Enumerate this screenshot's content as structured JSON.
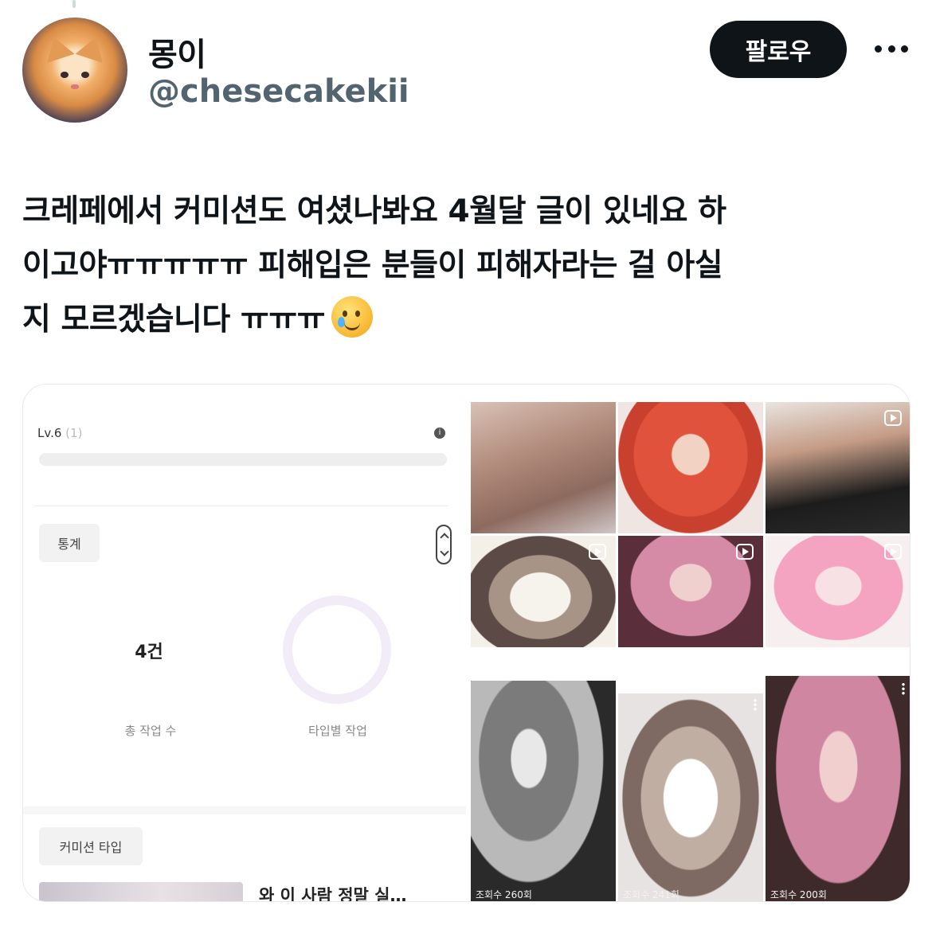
{
  "tweet": {
    "author": {
      "display_name": "몽이",
      "handle": "@chesecakekii",
      "avatar_icon": "kitten-avatar"
    },
    "follow_label": "팔로우",
    "more_icon": "more-horizontal-icon",
    "text": "크레페에서 커미션도 여셨나봐요 4월달 글이 있네요 하\n이고야ㅠㅠㅠㅠㅠ 피해입은 분들이 피해자라는 걸 아실\n지 모르겠습니다 ㅠㅠㅠ",
    "emoji": "smiling-face-with-tear",
    "colors": {
      "text": "#0f1419",
      "secondary": "#536471",
      "follow_bg": "#0f1419"
    }
  },
  "media": {
    "left_screenshot": {
      "level_label": "Lv.6",
      "level_count": "(1)",
      "stats_tab": "통계",
      "total_value": "4건",
      "total_label": "총 작업 수",
      "type_label": "타입별 작업",
      "commission_tab": "커미션 타입",
      "post_title": "와 이 사람 정말 실…"
    },
    "right_grid": {
      "top_tiles": [
        "man-torso",
        "red-hair-woman",
        "shirtless-man",
        "shocked-cat",
        "pink-hair-woman",
        "pink-hair-girl"
      ],
      "bottom_tiles": [
        "sketch-man",
        "shocked-cat",
        "pink-hair-woman"
      ],
      "bottom_views": [
        "조회수 260회",
        "조회수 241회",
        "조회수 200회"
      ]
    }
  }
}
